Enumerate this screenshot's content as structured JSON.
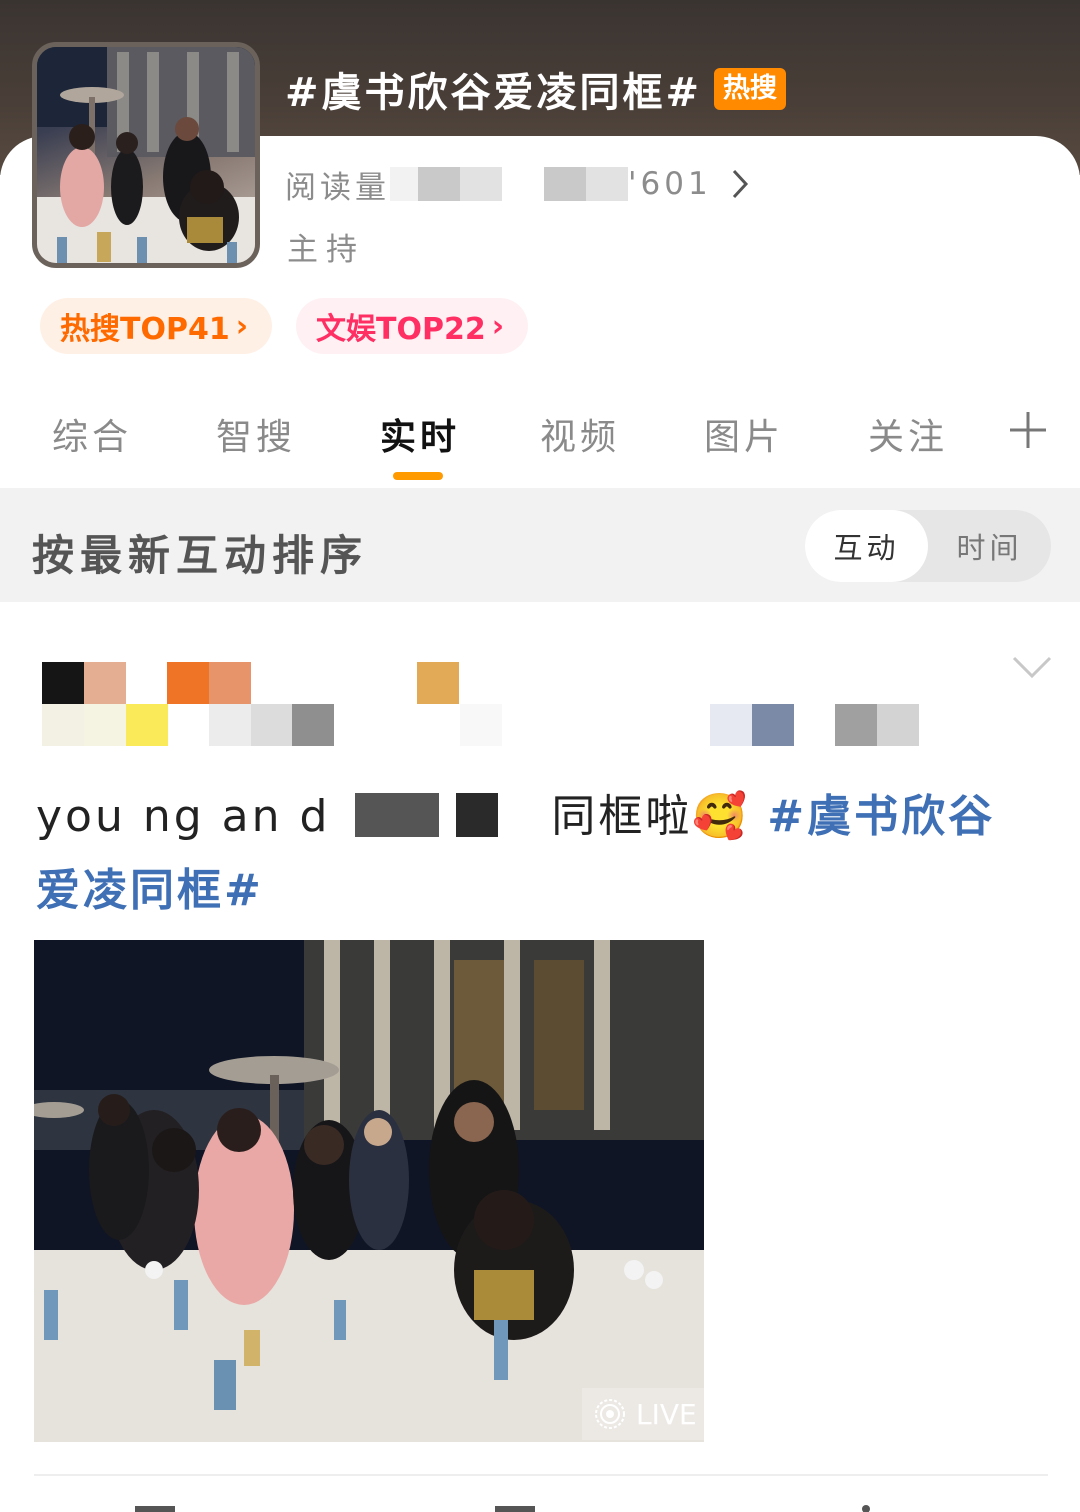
{
  "topic": {
    "title": "#虞书欣谷爱凌同框#",
    "badge": "热搜",
    "stats_prefix": "阅读量",
    "stats_suffix": "'601",
    "host_label": "主持"
  },
  "rank_chips": [
    {
      "label": "热搜TOP41",
      "chevron": "›"
    },
    {
      "label": "文娱TOP22",
      "chevron": "›"
    }
  ],
  "tabs": [
    {
      "label": "综合"
    },
    {
      "label": "智搜"
    },
    {
      "label": "实时"
    },
    {
      "label": "视频"
    },
    {
      "label": "图片"
    },
    {
      "label": "关注"
    }
  ],
  "sort": {
    "label": "按最新互动排序",
    "option_on": "互动",
    "option_off": "时间"
  },
  "post": {
    "text_fragment": "you  ng  an  d",
    "text_middle": "同框啦",
    "emoji": "🥰",
    "hashtag": "#虞书欣谷爱凌同框#",
    "live_label": "LIVE"
  },
  "colors": {
    "accent": "#ff9a00",
    "hot_badge": "#ff8a00",
    "hashtag": "#3f6fb5",
    "entertainment": "#ff2f64"
  }
}
